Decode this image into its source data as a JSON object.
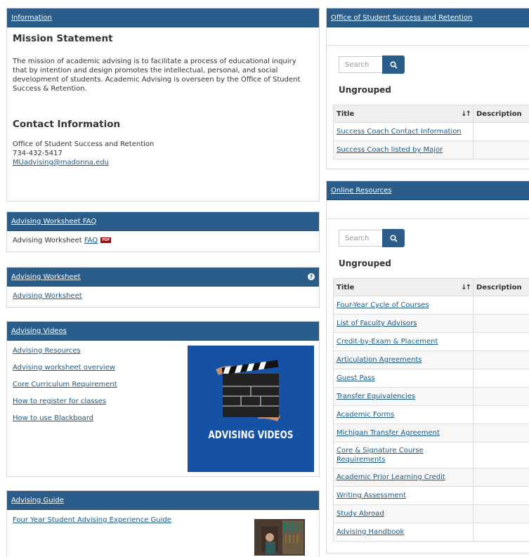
{
  "information": {
    "header": "Information",
    "mission_title": "Mission Statement",
    "mission_text": "The mission of academic advising is to facilitate a process of educational inquiry that by intention and design promotes the intellectual, personal, and social development of students. Academic Advising is overseen by the Office of Student Success & Retention.",
    "contact_title": "Contact Information",
    "contact_office": "Office of Student Success and Retention",
    "contact_phone": "734-432-5417",
    "contact_email": "MUadvising@madonna.edu"
  },
  "worksheet_faq": {
    "header": "Advising Worksheet FAQ",
    "text": "Advising Worksheet ",
    "link": "FAQ",
    "badge": "PDF"
  },
  "worksheet": {
    "header": "Advising Worksheet",
    "link": "Advising Worksheet"
  },
  "videos": {
    "header": "Advising Videos",
    "links": [
      "Advising Resources",
      "Advising worksheet overview",
      "Core Curriculum Requirement",
      "How to register for classes",
      "How to use Blackboard"
    ],
    "image_caption": "ADVISING VIDEOS",
    "image_bg": "#1552a6"
  },
  "guide": {
    "header": "Advising Guide",
    "link": "Four Year Student Advising Experience Guide"
  },
  "success": {
    "header": "Office of Student Success and Retention",
    "search_placeholder": "Search",
    "group_title": "Ungrouped",
    "col_title": "Title",
    "col_desc": "Description",
    "rows": [
      "Success Coach Contact Information",
      "Success Coach listed by Major"
    ]
  },
  "online": {
    "header": "Online Resources",
    "search_placeholder": "Search",
    "group_title": "Ungrouped",
    "col_title": "Title",
    "col_desc": "Description",
    "rows": [
      "Four-Year Cycle of Courses",
      "List of Faculty Advisors",
      "Credit-by-Exam & Placement",
      "Articulation Agreements",
      "Guest Pass",
      "Transfer Equivalencies",
      "Academic Forms",
      "Michigan Transfer Agreement",
      "Core & Signature Course Requirements",
      "Academic Prior Learning Credit",
      "Writing Assessment",
      "Study Abroad",
      "Advising Handbook"
    ]
  },
  "colors": {
    "header_bg": "#2b5d8b",
    "link": "#1a5a8a",
    "pdf_badge": "#b20000"
  }
}
